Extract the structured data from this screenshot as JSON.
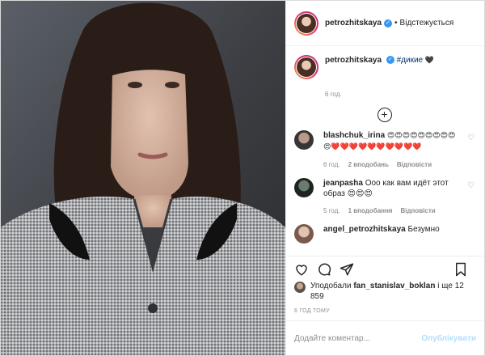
{
  "post": {
    "author": "petrozhitskaya",
    "follow_status": "Відстежується",
    "more_icon": "more-horizontal-icon"
  },
  "caption": {
    "author": "petrozhitskaya",
    "hashtag": "#дикие",
    "emoji": "🖤",
    "time": "6 год."
  },
  "comments": [
    {
      "author": "blashchuk_irina",
      "text": "😍😍😍😍😍😍😍😍😍😍❤️❤️❤️❤️❤️❤️❤️❤️❤️❤️",
      "time": "6 год.",
      "likes": "2 вподобань",
      "reply": "Відповісти"
    },
    {
      "author": "jeanpasha",
      "text": "Ооо как вам идёт этот образ 😍😍😍",
      "time": "5 год.",
      "likes": "1 вподобання",
      "reply": "Відповісти"
    },
    {
      "author": "angel_petrozhitskaya",
      "text": "Безумно"
    }
  ],
  "likes": {
    "prefix": "Уподобали",
    "user": "fan_stanislav_boklan",
    "suffix": "і ще 12 859"
  },
  "posted_ago": "6 ГОД ТОМУ",
  "add_comment": {
    "placeholder": "Додайте коментар...",
    "publish": "Опублікувати"
  },
  "colors": {
    "verified": "#3897f0",
    "link": "#00376b",
    "muted": "#8e8e8e",
    "publish_disabled": "#b2dffc"
  }
}
